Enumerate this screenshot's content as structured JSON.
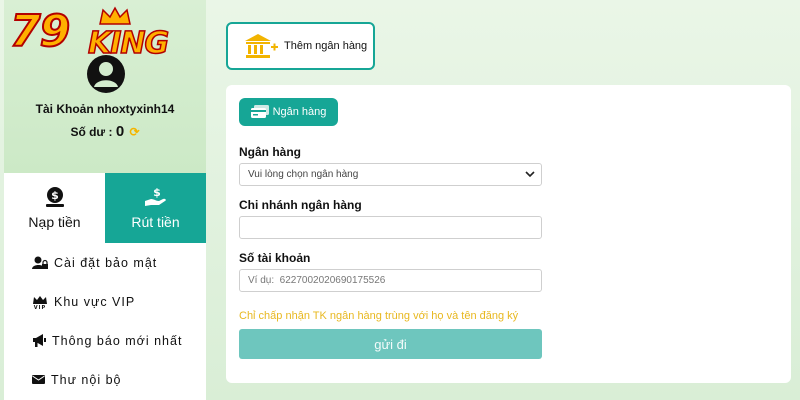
{
  "logo": {
    "number": "79",
    "word": "KING"
  },
  "profile": {
    "account_label": "Tài Khoản nhoxtyxinh14",
    "balance_label": "Số dư :",
    "balance_value": "0"
  },
  "tabs": [
    {
      "label": "Nạp tiền",
      "icon": "money-bag-icon"
    },
    {
      "label": "Rút tiền",
      "icon": "hand-dollar-icon"
    }
  ],
  "menu": [
    {
      "label": "Cài đặt bảo mật",
      "icon": "user-lock-icon"
    },
    {
      "label": "Khu vực VIP",
      "icon": "vip-crown-icon"
    },
    {
      "label": "Thông báo mới nhất",
      "icon": "megaphone-icon"
    },
    {
      "label": "Thư nội bộ",
      "icon": "envelope-icon"
    }
  ],
  "add_bank": {
    "label": "Thêm ngân hàng",
    "icon": "bank-plus-icon"
  },
  "form": {
    "chip_label": "Ngân hàng",
    "bank_label": "Ngân hàng",
    "bank_select_value": "Vui lòng chọn ngân hàng",
    "branch_label": "Chi nhánh ngân hàng",
    "branch_value": "",
    "account_label": "Số tài khoản",
    "account_placeholder": "Ví dụ:  6227002020690175526",
    "note": "Chỉ chấp nhận TK ngân hàng trùng với họ và tên đăng ký",
    "submit_label": "gửi đi"
  },
  "colors": {
    "accent": "#16a696",
    "submit_disabled": "#6ec6be",
    "note": "#e8b820",
    "logo_gold": "#ffb000",
    "logo_red": "#b30000"
  }
}
